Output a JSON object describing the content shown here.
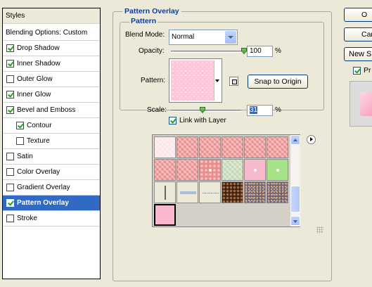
{
  "styles_list": {
    "header": "Styles",
    "blending_options": "Blending Options: Custom",
    "items": [
      {
        "label": "Drop Shadow",
        "checked": true
      },
      {
        "label": "Inner Shadow",
        "checked": true
      },
      {
        "label": "Outer Glow",
        "checked": false
      },
      {
        "label": "Inner Glow",
        "checked": true
      },
      {
        "label": "Bevel and Emboss",
        "checked": true
      },
      {
        "label": "Contour",
        "checked": true
      },
      {
        "label": "Texture",
        "checked": false
      },
      {
        "label": "Satin",
        "checked": false
      },
      {
        "label": "Color Overlay",
        "checked": false
      },
      {
        "label": "Gradient Overlay",
        "checked": false
      },
      {
        "label": "Pattern Overlay",
        "checked": true,
        "selected": true
      },
      {
        "label": "Stroke",
        "checked": false
      }
    ]
  },
  "pattern_overlay": {
    "group_title": "Pattern Overlay",
    "sub_title": "Pattern",
    "blend_mode_label": "Blend Mode:",
    "blend_mode_value": "Normal",
    "opacity_label": "Opacity:",
    "opacity_value": "100",
    "opacity_unit": "%",
    "opacity_level": 1.0,
    "pattern_label": "Pattern:",
    "snap_button": "Snap to Origin",
    "scale_label": "Scale:",
    "scale_value": "31",
    "scale_unit": "%",
    "scale_level": 0.31,
    "link_label": "Link with Layer",
    "link_checked": true
  },
  "pattern_picker": {
    "rows": [
      [
        "pale",
        "hatch",
        "hatch",
        "hatch",
        "hatch",
        "hatch"
      ],
      [
        "hatch",
        "hatch",
        "dots",
        "green",
        "pink2",
        "lime"
      ],
      [
        "vbar",
        "hbar",
        "dline",
        "dark",
        "noise",
        "noise"
      ],
      [
        "solidpink"
      ]
    ],
    "selected": "solidpink"
  },
  "dialog_buttons": {
    "ok": "O",
    "cancel": "Can",
    "new_style": "New S",
    "preview_label": "Pr",
    "preview_checked": true
  },
  "icons": {
    "scroll_up": "scroll-up-arrow-icon",
    "scroll_down": "scroll-down-arrow-icon",
    "picker_menu": "menu-arrow-icon",
    "new_preset": "new-preset-icon",
    "dropdown": "chevron-down-icon"
  }
}
